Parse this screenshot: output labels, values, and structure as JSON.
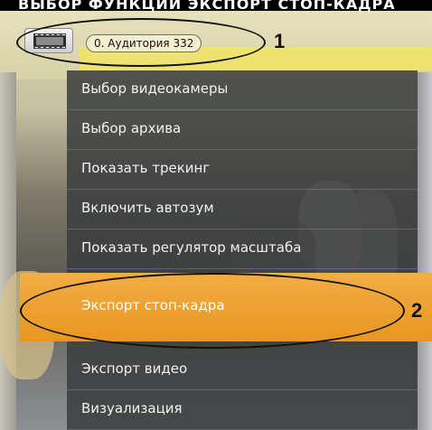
{
  "header": {
    "title": "ВЫБОР ФУНКЦИИ ЭКСПОРТ СТОП-КАДРА"
  },
  "camera": {
    "icon": "film-icon",
    "label": "0. Аудитория 332"
  },
  "callouts": {
    "one": "1",
    "two": "2"
  },
  "menu": {
    "items": [
      {
        "label": "Выбор видеокамеры"
      },
      {
        "label": "Выбор архива"
      },
      {
        "label": "Показать трекинг"
      },
      {
        "label": "Включить автозум"
      },
      {
        "label": "Показать регулятор масштаба"
      },
      {
        "label": "Экспорт стоп-кадра",
        "highlighted": true
      },
      {
        "label": "Экспорт видео"
      },
      {
        "label": "Визуализация"
      }
    ],
    "highlight_color": "#e8961f"
  }
}
